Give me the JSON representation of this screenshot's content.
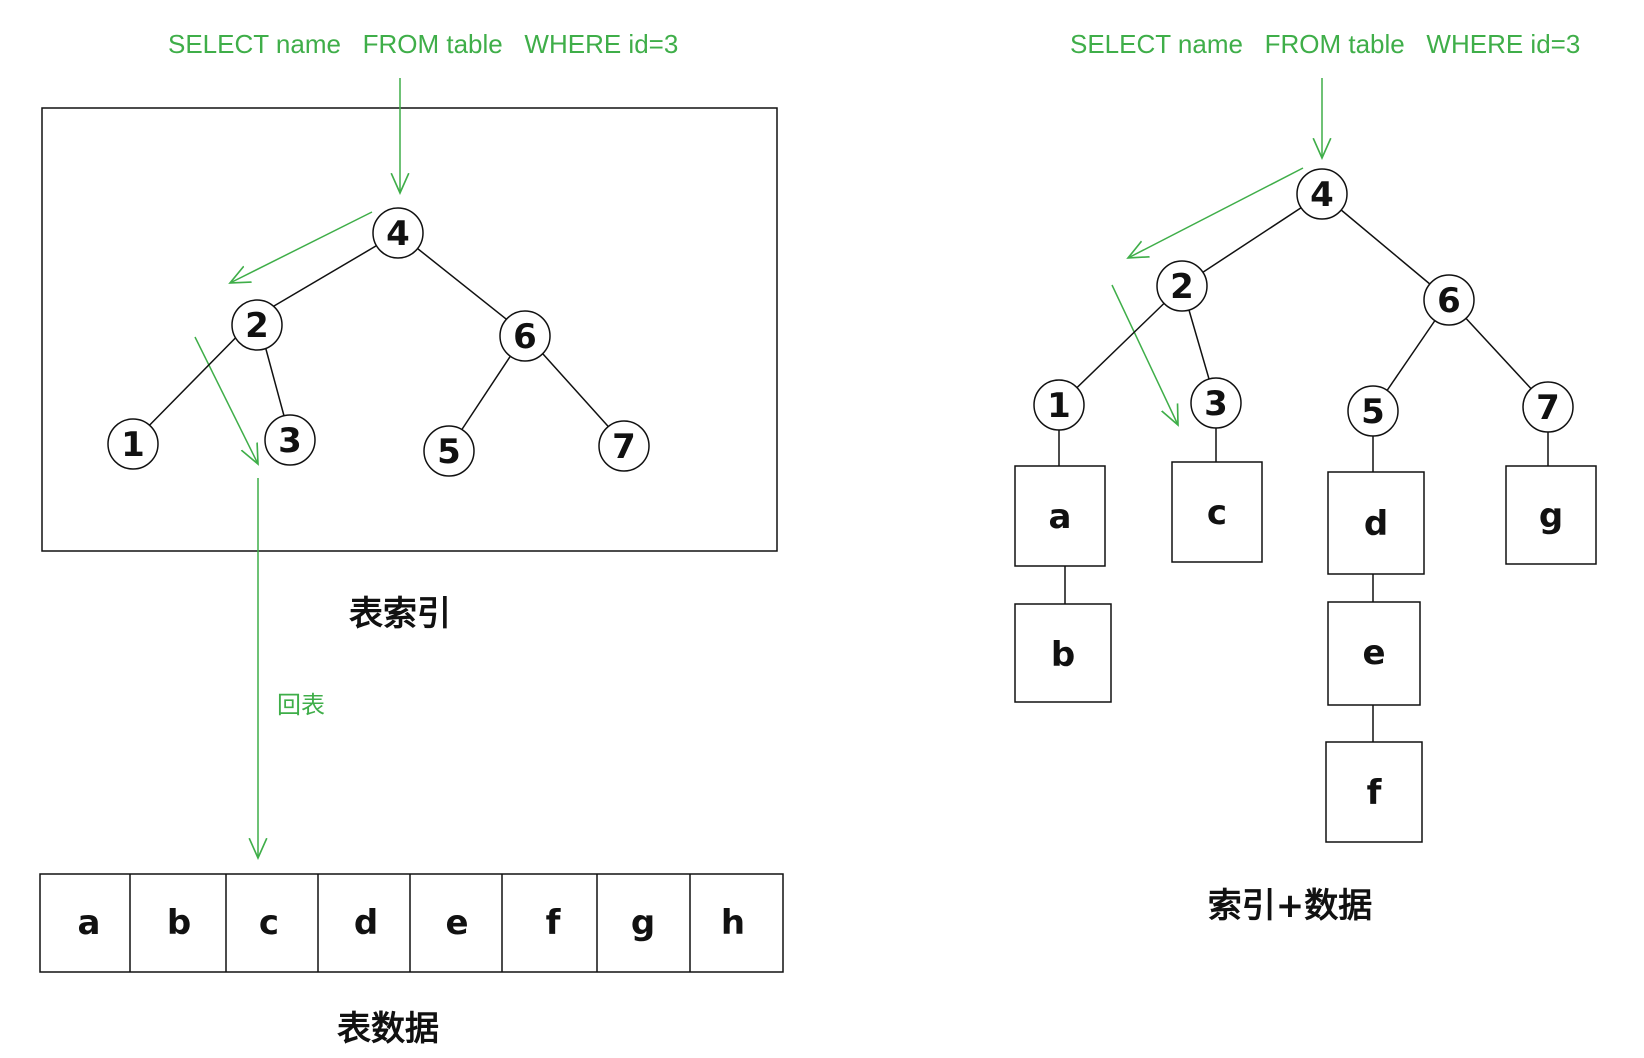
{
  "left": {
    "sql": "SELECT name   FROM table   WHERE id=3",
    "index_caption": "表索引",
    "back_table_label": "回表",
    "data_caption": "表数据",
    "tree_nodes": [
      "4",
      "2",
      "6",
      "1",
      "3",
      "5",
      "7"
    ],
    "table_cells": [
      "a",
      "b",
      "c",
      "d",
      "e",
      "f",
      "g",
      "h"
    ]
  },
  "right": {
    "sql": "SELECT name   FROM table   WHERE id=3",
    "caption": "索引+数据",
    "tree_nodes": [
      "4",
      "2",
      "6",
      "1",
      "3",
      "5",
      "7"
    ],
    "leaf_data": [
      "a",
      "b",
      "c",
      "d",
      "e",
      "f",
      "g"
    ]
  },
  "colors": {
    "annotation_green": "#3fae49",
    "ink": "#111111"
  }
}
